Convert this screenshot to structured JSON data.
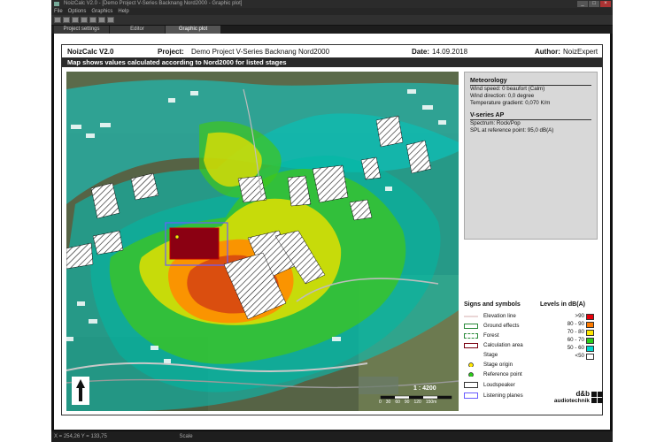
{
  "window": {
    "title": "NoizCalc V2.0 - [Demo Project V-Series Backnang Nord2000 - Graphic plot]",
    "menu": [
      "File",
      "Options",
      "Graphics",
      "Help"
    ],
    "toolbar_icons": [
      "new-icon",
      "save-icon",
      "print-icon",
      "zoom-icon",
      "zoom-out-icon",
      "grid-icon",
      "info-icon"
    ],
    "tabs": [
      {
        "label": "Project settings",
        "active": false
      },
      {
        "label": "Editor",
        "active": false
      },
      {
        "label": "Graphic plot",
        "active": true
      }
    ]
  },
  "plot": {
    "app_name": "NoizCalc V2.0",
    "project_label": "Project:",
    "project_value": "Demo Project V-Series Backnang Nord2000",
    "date_label": "Date:",
    "date_value": "14.09.2018",
    "author_label": "Author:",
    "author_value": "NoizExpert",
    "banner": "Map shows values calculated according to Nord2000 for listed stages",
    "scale": "1 : 4200",
    "scale_ticks": [
      "0",
      "30",
      "60",
      "90",
      "120",
      "150m"
    ]
  },
  "info_panel": {
    "meteorology_title": "Meteorology",
    "wind_speed": "Wind speed:  0 beaufort (Calm)",
    "wind_direction": "Wind direction:  0,0 degree",
    "temp_gradient": "Temperature gradient:  0,070 K/m",
    "stage_title": "V-series AP",
    "spectrum": "Spectrum:   Rock/Pop",
    "spl": "SPL at reference point:  95,0 dB(A)"
  },
  "legend": {
    "symbols_title": "Signs and symbols",
    "symbols": [
      "Elevation line",
      "Ground effects",
      "Forest",
      "Calculation area",
      "Stage",
      "Stage origin",
      "Reference point",
      "Loudspeaker",
      "Listening planes"
    ],
    "levels_title": "Levels in dB(A)",
    "levels": [
      {
        "label": ">90",
        "color": "#e8000a"
      },
      {
        "label": "80 - 90",
        "color": "#ff7b00"
      },
      {
        "label": "70 - 80",
        "color": "#ffe600"
      },
      {
        "label": "60 - 70",
        "color": "#2bcc1a"
      },
      {
        "label": "50 - 60",
        "color": "#00d8d0"
      },
      {
        "label": "<50",
        "color": "#ffffff"
      }
    ],
    "brand_line1": "d&b",
    "brand_line2": "audiotechnik"
  },
  "status": {
    "coords": "X = 254,26  Y = 133,75",
    "scale_label": "Scale"
  }
}
